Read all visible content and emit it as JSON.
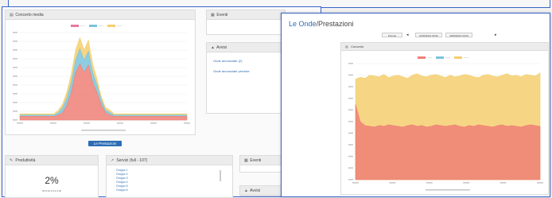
{
  "back": {
    "chart_panel": {
      "title": "Concerto media",
      "icon": "bar-chart-icon"
    },
    "eventi_panel": {
      "title": "Eventi",
      "icon": "calendar-icon"
    },
    "avvisi_panel": {
      "title": "Avvisi",
      "icon": "bell-icon",
      "links": [
        "Onde annunciate (2)",
        "Onde annunciate previste"
      ]
    },
    "prestazioni_button": "Le Prestazioni",
    "productivity_panel": {
      "title": "Produttività",
      "icon": "wrench-icon",
      "value": "2%",
      "subtext": "30.8.12.0.3.2.3.20"
    },
    "services_panel": {
      "title": "Servizi (full - 107)",
      "icon": "chart-icon",
      "items": [
        "Gruppo 1",
        "Gruppo 2",
        "Gruppo 3",
        "Gruppo 4",
        "Gruppo 5",
        "Gruppo 6"
      ]
    },
    "eventi2_panel": {
      "title": "Eventi",
      "icon": "calendar-icon"
    },
    "avvisi2_panel": {
      "title": "Avvisi",
      "icon": "bell-icon"
    }
  },
  "front": {
    "title_link": "Le Onde",
    "title_rest": "/Prestazioni",
    "selects": [
      "Periodo",
      "01/09/2014 00:00",
      "30/09/2014 00:00"
    ],
    "panel_title": "Concerto",
    "panel_icon": "bar-chart-icon"
  },
  "colors": {
    "accent": "#2d6cb5",
    "red": "#ef8076",
    "yellow": "#f5cf6e",
    "blue": "#7bc3dc",
    "pink": "#e87a9c"
  },
  "chart_data": [
    {
      "type": "area",
      "series": [
        {
          "color": "#ef8076",
          "values": [
            3,
            3,
            3,
            3,
            3,
            3,
            3,
            3,
            3,
            4,
            6,
            12,
            22,
            38,
            45,
            38,
            44,
            30,
            22,
            12,
            6,
            4,
            3,
            3,
            3,
            3,
            3,
            3,
            3,
            3,
            3,
            3,
            3,
            3,
            3,
            3,
            3,
            3,
            3,
            3
          ]
        },
        {
          "color": "#7bc3dc",
          "values": [
            1,
            1,
            1,
            1,
            1,
            1,
            1,
            1,
            1,
            2,
            4,
            6,
            8,
            10,
            12,
            10,
            11,
            8,
            6,
            4,
            2,
            2,
            1,
            1,
            1,
            1,
            1,
            1,
            1,
            1,
            1,
            1,
            1,
            1,
            1,
            1,
            1,
            1,
            1,
            1
          ]
        },
        {
          "color": "#f5cf6e",
          "values": [
            1,
            1,
            1,
            1,
            1,
            1,
            1,
            1,
            1,
            2,
            3,
            5,
            7,
            8,
            9,
            8,
            9,
            7,
            5,
            3,
            2,
            2,
            1,
            1,
            1,
            1,
            1,
            1,
            1,
            1,
            1,
            1,
            1,
            1,
            1,
            1,
            1,
            1,
            1,
            1
          ]
        }
      ]
    },
    {
      "type": "area",
      "series": [
        {
          "color": "#f5cf6e",
          "values": [
            260,
            265,
            262,
            270,
            268,
            266,
            272,
            264,
            268,
            270,
            266,
            262,
            270,
            274,
            268,
            266,
            270,
            272,
            268,
            264,
            270,
            266,
            268,
            272,
            270,
            266,
            264,
            270,
            272,
            268,
            266,
            270,
            274,
            268,
            270,
            266,
            272,
            270,
            268,
            276
          ]
        },
        {
          "color": "#ef8076",
          "values": [
            195,
            150,
            140,
            138,
            136,
            140,
            138,
            142,
            140,
            138,
            136,
            140,
            142,
            138,
            140,
            136,
            138,
            142,
            140,
            138,
            140,
            142,
            138,
            136,
            140,
            138,
            142,
            140,
            138,
            136,
            140,
            142,
            138,
            140,
            138,
            136,
            140,
            142,
            140,
            138
          ]
        }
      ]
    }
  ]
}
